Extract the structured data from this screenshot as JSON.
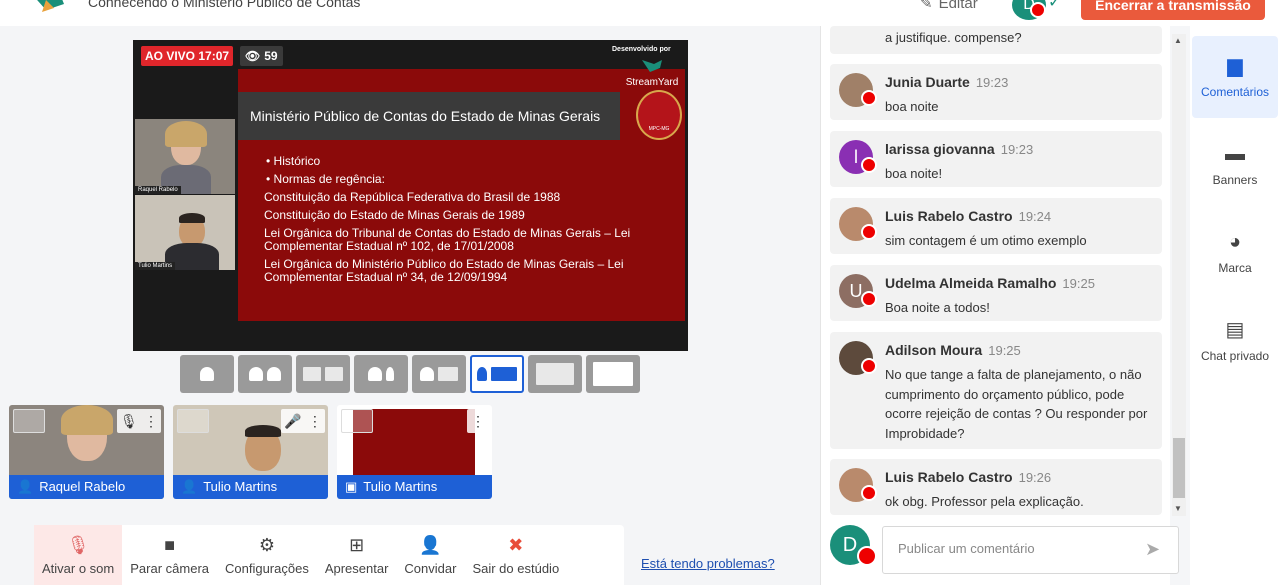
{
  "header": {
    "broadcast_title": "Conhecendo o Ministério Público de Contas",
    "edit_label": "Editar",
    "avatar_initial": "D",
    "end_button": "Encerrar a transmissão"
  },
  "stage": {
    "live_label": "AO VIVO 17:07",
    "viewers": "59",
    "developed_by": "Desenvolvido por",
    "brand": "StreamYard",
    "cameras": [
      {
        "name": "Raquel Rabelo"
      },
      {
        "name": "Tulio Martins"
      }
    ],
    "slide": {
      "title": "Ministério Público de Contas do Estado de Minas Gerais",
      "emblem_text": "MPC-MG",
      "lines": [
        "• Histórico",
        "• Normas de regência:",
        "Constituição da República Federativa do Brasil de 1988",
        "Constituição do Estado de Minas Gerais de 1989",
        "Lei Orgânica do Tribunal de Contas do Estado de Minas Gerais – Lei Complementar Estadual nº 102, de 17/01/2008",
        "Lei Orgânica do Ministério Público do Estado de Minas Gerais – Lei Complementar Estadual nº 34, de 12/09/1994"
      ]
    }
  },
  "layouts": [
    "solo",
    "group",
    "group-2",
    "leader",
    "side-by-side",
    "presentation",
    "presentation-only",
    "fullscreen"
  ],
  "participants": [
    {
      "name": "Raquel Rabelo",
      "type": "person"
    },
    {
      "name": "Tulio Martins",
      "type": "person"
    },
    {
      "name": "Tulio Martins",
      "type": "screen"
    }
  ],
  "controls": {
    "unmute": "Ativar o som",
    "stop_camera": "Parar câmera",
    "settings": "Configurações",
    "present": "Apresentar",
    "invite": "Convidar",
    "leave": "Sair do estúdio"
  },
  "problems_link": "Está tendo problemas?",
  "chat": {
    "partial_top": "a justifique. compense?",
    "messages": [
      {
        "author": "Junia Duarte",
        "time": "19:23",
        "text": "boa noite",
        "initial": ""
      },
      {
        "author": "larissa giovanna",
        "time": "19:23",
        "text": "boa noite!",
        "initial": "l"
      },
      {
        "author": "Luis Rabelo Castro",
        "time": "19:24",
        "text": "sim contagem é um otimo exemplo",
        "initial": ""
      },
      {
        "author": "Udelma Almeida Ramalho",
        "time": "19:25",
        "text": "Boa noite a todos!",
        "initial": "U"
      },
      {
        "author": "Adilson Moura",
        "time": "19:25",
        "text": "No que tange a falta de planejamento, o não cumprimento do orçamento público, pode ocorre rejeição de contas ? Ou responder por Improbidade?",
        "initial": ""
      },
      {
        "author": "Luis Rabelo Castro",
        "time": "19:26",
        "text": "ok obg. Professor pela explicação.",
        "initial": ""
      }
    ],
    "composer_initial": "D",
    "composer_placeholder": "Publicar um comentário"
  },
  "side_nav": [
    {
      "label": "Comentários",
      "icon": "comment-icon"
    },
    {
      "label": "Banners",
      "icon": "banner-icon"
    },
    {
      "label": "Marca",
      "icon": "palette-icon"
    },
    {
      "label": "Chat privado",
      "icon": "private-chat-icon"
    }
  ],
  "colors": {
    "accent": "#1e60d6",
    "end_button": "#ea5a3c",
    "live": "#e0262b",
    "slide_bg": "#8b0a0a"
  }
}
